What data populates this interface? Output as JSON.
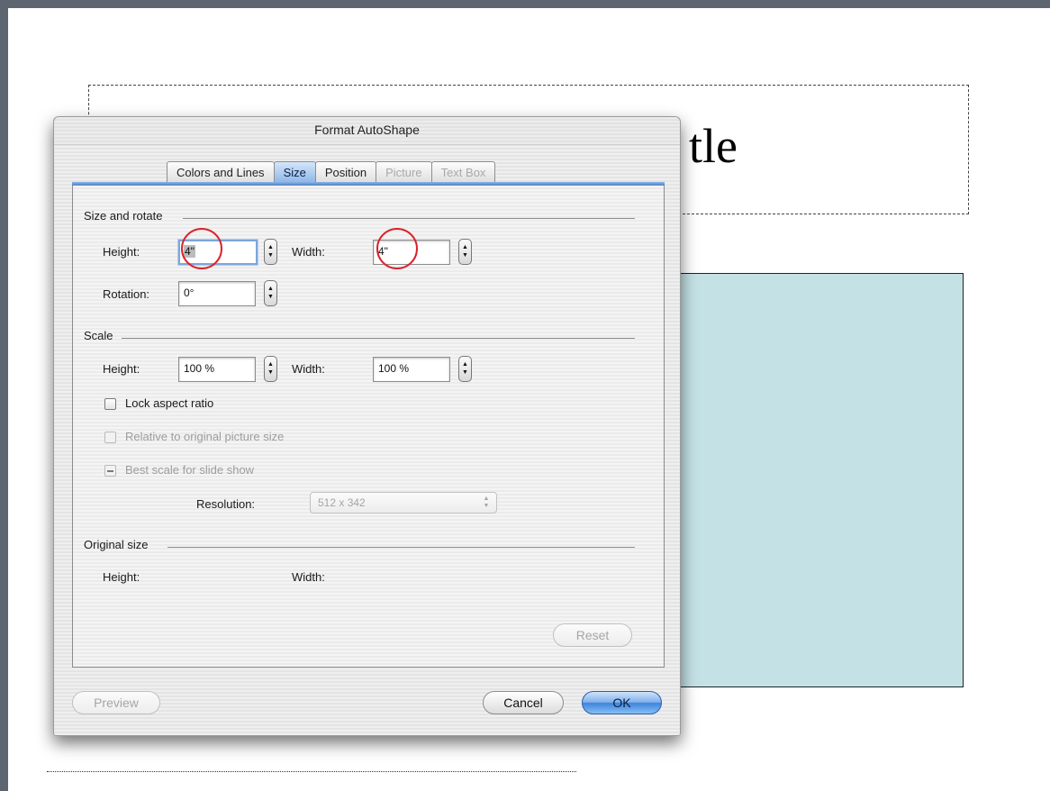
{
  "slide": {
    "title_text": "tle"
  },
  "dialog": {
    "title": "Format AutoShape",
    "tabs": [
      {
        "label": "Colors and Lines",
        "state": "normal"
      },
      {
        "label": "Size",
        "state": "active"
      },
      {
        "label": "Position",
        "state": "normal"
      },
      {
        "label": "Picture",
        "state": "disabled"
      },
      {
        "label": "Text Box",
        "state": "disabled"
      }
    ],
    "size_rotate": {
      "group_label": "Size and rotate",
      "height_label": "Height:",
      "height_value": "4\"",
      "width_label": "Width:",
      "width_value": "4\"",
      "rotation_label": "Rotation:",
      "rotation_value": "0°"
    },
    "scale": {
      "group_label": "Scale",
      "height_label": "Height:",
      "height_value": "100 %",
      "width_label": "Width:",
      "width_value": "100 %",
      "lock_aspect_label": "Lock aspect ratio",
      "relative_label": "Relative to original picture size",
      "best_scale_label": "Best scale for slide show",
      "resolution_label": "Resolution:",
      "resolution_value": "512 x 342"
    },
    "original_size": {
      "group_label": "Original size",
      "height_label": "Height:",
      "width_label": "Width:"
    },
    "buttons": {
      "reset": "Reset",
      "preview": "Preview",
      "cancel": "Cancel",
      "ok": "OK"
    }
  },
  "colors": {
    "accent_blue": "#4c7fc9",
    "highlight_red": "#d9232a",
    "shape_fill": "#c4e2e6"
  },
  "icons": {
    "stepper": "stepper-arrows-icon",
    "popup": "popup-arrows-icon"
  }
}
